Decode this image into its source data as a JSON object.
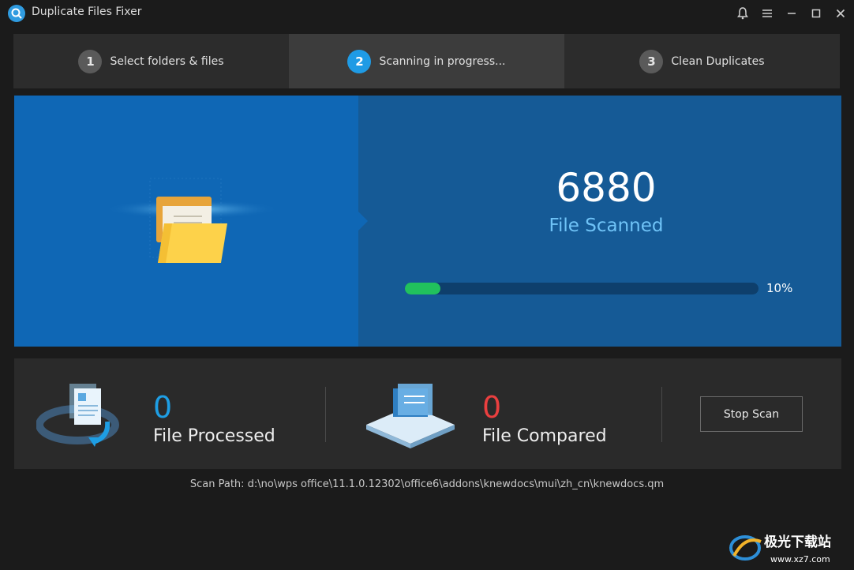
{
  "window": {
    "title": "Duplicate Files Fixer",
    "controls": [
      "bell-icon",
      "menu-icon",
      "minimize-icon",
      "maximize-icon",
      "close-icon"
    ]
  },
  "steps": [
    {
      "num": "1",
      "label": "Select folders & files",
      "active": false
    },
    {
      "num": "2",
      "label": "Scanning in progress...",
      "active": true
    },
    {
      "num": "3",
      "label": "Clean Duplicates",
      "active": false
    }
  ],
  "scan": {
    "count": "6880",
    "label": "File Scanned",
    "progress_percent": 10,
    "progress_text": "10%"
  },
  "stats": {
    "processed": {
      "value": "0",
      "label": "File Processed",
      "color": "#1e9ee4"
    },
    "compared": {
      "value": "0",
      "label": "File Compared",
      "color": "#ea3f3f"
    },
    "stop_button": "Stop Scan"
  },
  "scan_path": "Scan Path: d:\\no\\wps office\\11.1.0.12302\\office6\\addons\\knewdocs\\mui\\zh_cn\\knewdocs.qm",
  "watermark": {
    "text": "极光下载站",
    "url_text": "www.xz7.com"
  },
  "colors": {
    "accent": "#1f9be5",
    "progress": "#21c15d",
    "panel_left": "#0f67b5",
    "panel_right": "#155a96"
  }
}
